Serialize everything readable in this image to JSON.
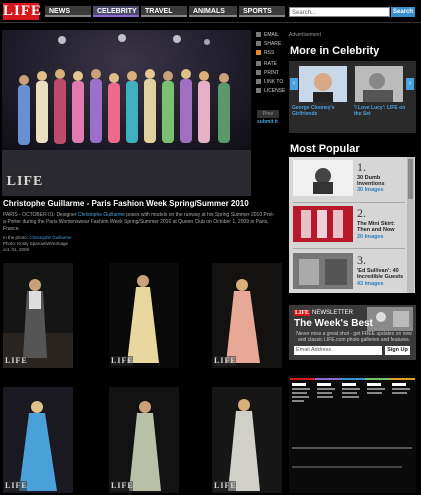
{
  "header": {
    "logo": "LIFE",
    "nav": [
      "NEWS",
      "CELEBRITY",
      "TRAVEL",
      "ANIMALS",
      "SPORTS"
    ],
    "active_nav": "CELEBRITY",
    "search_placeholder": "Search...",
    "search_button": "Search"
  },
  "share": {
    "items": [
      "EMAIL",
      "SHARE",
      "RSS",
      "RATE",
      "PRINT",
      "LINK TO",
      "LICENSE"
    ],
    "prev": "Prev",
    "submit": "submit it"
  },
  "photo": {
    "badge": "LIFE",
    "title": "Christophe Guillarme - Paris Fashion Week Spring/Summer 2010",
    "desc_pre": "PARIS - OCTOBER 01: Designer ",
    "desc_link": "Christophe Guillarme",
    "desc_post": " poses with models on the runway at his Spring Summer 2010 Pret-a-Porter during the Paris Womenswear Fashion Week Spring/Summer 2010 at Queen Club on October 1, 2009 in Paris, France.",
    "in_photo_label": "In the photo: ",
    "in_photo_name": "Christophe Guillarme",
    "credit": "Photo: Kristy Sparow/WireImage",
    "date": "oct. 01, 2009"
  },
  "thumbs": {
    "badge": "LIFE"
  },
  "right": {
    "advert": "Advertisement",
    "more_title": "More in Celebrity",
    "more_items": [
      "George Clooney's Girlfriends",
      "'I Love Lucy': LIFE on the Set"
    ],
    "popular_title": "Most Popular",
    "popular": [
      {
        "num": "1.",
        "title": "30 Dumb Inventions",
        "count": "30 Images"
      },
      {
        "num": "2.",
        "title": "The Mini Skirt: Then and Now",
        "count": "20 Images"
      },
      {
        "num": "3.",
        "title": "'Ed Sullivan': 40 Incredible Guests",
        "count": "43 Images"
      }
    ]
  },
  "newsletter": {
    "logo": "LIFE",
    "label": "NEWSLETTER",
    "headline": "The Week's Best",
    "desc": "Never miss a great shot - get FREE updates on new and classic LIFE.com photo galleries and features.",
    "email_placeholder": "Email Address",
    "signup": "Sign Up"
  },
  "colors": {
    "brand_red": "#d9161b",
    "link_blue": "#4aa3df"
  }
}
